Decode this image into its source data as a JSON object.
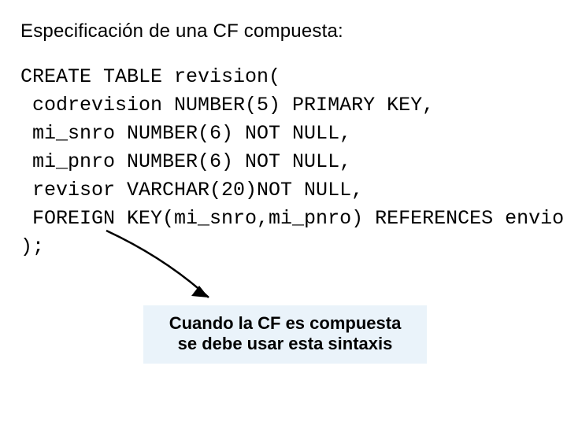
{
  "heading": "Especificación de una CF compuesta:",
  "code": {
    "line1": "CREATE TABLE revision(",
    "line2": " codrevision NUMBER(5) PRIMARY KEY,",
    "line3": " mi_snro NUMBER(6) NOT NULL,",
    "line4": " mi_pnro NUMBER(6) NOT NULL,",
    "line5": " revisor VARCHAR(20)NOT NULL,",
    "line6": " FOREIGN KEY(mi_snro,mi_pnro) REFERENCES envio",
    "line7": ");"
  },
  "callout": {
    "line1": "Cuando la CF es compuesta",
    "line2": "se debe usar esta sintaxis"
  }
}
